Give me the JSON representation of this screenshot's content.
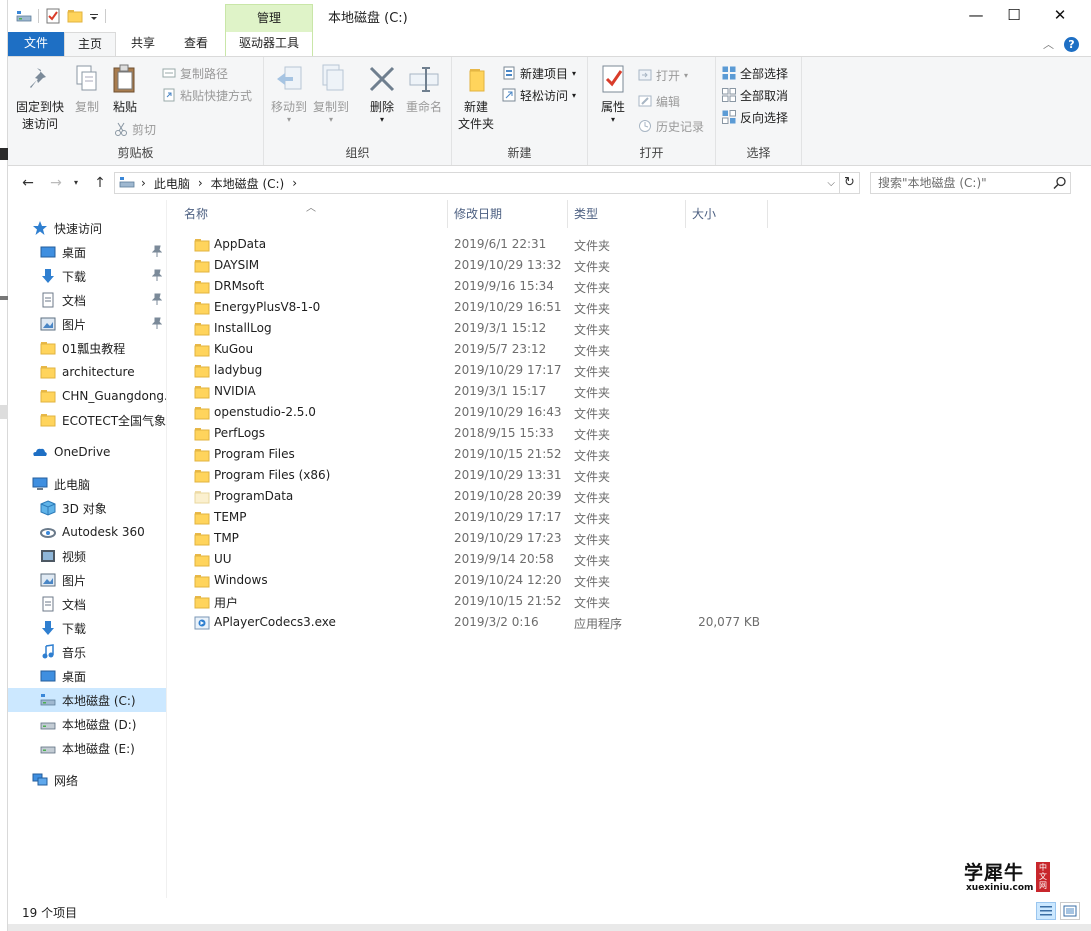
{
  "window": {
    "title": "本地磁盘 (C:)",
    "context_tab": "管理",
    "controls": {
      "minimize": "—",
      "maximize": "☐",
      "close": "✕"
    }
  },
  "tabs": {
    "file": "文件",
    "home": "主页",
    "share": "共享",
    "view": "查看",
    "drive_tools": "驱动器工具",
    "collapse": "︿",
    "help": "?"
  },
  "ribbon": {
    "clipboard": {
      "label": "剪贴板",
      "pin_quick_access": "固定到快\n速访问",
      "copy": "复制",
      "paste": "粘贴",
      "copy_path": "复制路径",
      "paste_shortcut": "粘贴快捷方式",
      "cut": "剪切"
    },
    "organize": {
      "label": "组织",
      "move_to": "移动到",
      "copy_to": "复制到",
      "delete": "删除",
      "rename": "重命名"
    },
    "new": {
      "label": "新建",
      "new_folder": "新建\n文件夹",
      "new_item": "新建项目",
      "easy_access": "轻松访问"
    },
    "open": {
      "label": "打开",
      "properties": "属性",
      "open": "打开",
      "edit": "编辑",
      "history": "历史记录"
    },
    "select": {
      "label": "选择",
      "select_all": "全部选择",
      "select_none": "全部取消",
      "invert": "反向选择"
    }
  },
  "address": {
    "crumbs": [
      "此电脑",
      "本地磁盘 (C:)"
    ],
    "search_placeholder": "搜索\"本地磁盘 (C:)\""
  },
  "nav": {
    "quick_access": "快速访问",
    "quick_items": [
      "桌面",
      "下载",
      "文档",
      "图片",
      "01瓢虫教程",
      "architecture",
      "CHN_Guangdong.",
      "ECOTECT全国气象"
    ],
    "onedrive": "OneDrive",
    "this_pc": "此电脑",
    "pc_items": [
      "3D 对象",
      "Autodesk 360",
      "视频",
      "图片",
      "文档",
      "下载",
      "音乐",
      "桌面",
      "本地磁盘 (C:)",
      "本地磁盘 (D:)",
      "本地磁盘 (E:)"
    ],
    "network": "网络"
  },
  "columns": {
    "name": "名称",
    "date": "修改日期",
    "type": "类型",
    "size": "大小"
  },
  "files": [
    {
      "name": "AppData",
      "date": "2019/6/1 22:31",
      "type": "文件夹",
      "size": "",
      "icon": "folder-icon"
    },
    {
      "name": "DAYSIM",
      "date": "2019/10/29 13:32",
      "type": "文件夹",
      "size": "",
      "icon": "folder-icon"
    },
    {
      "name": "DRMsoft",
      "date": "2019/9/16 15:34",
      "type": "文件夹",
      "size": "",
      "icon": "folder-icon"
    },
    {
      "name": "EnergyPlusV8-1-0",
      "date": "2019/10/29 16:51",
      "type": "文件夹",
      "size": "",
      "icon": "folder-icon"
    },
    {
      "name": "InstallLog",
      "date": "2019/3/1 15:12",
      "type": "文件夹",
      "size": "",
      "icon": "folder-icon"
    },
    {
      "name": "KuGou",
      "date": "2019/5/7 23:12",
      "type": "文件夹",
      "size": "",
      "icon": "folder-icon"
    },
    {
      "name": "ladybug",
      "date": "2019/10/29 17:17",
      "type": "文件夹",
      "size": "",
      "icon": "folder-icon"
    },
    {
      "name": "NVIDIA",
      "date": "2019/3/1 15:17",
      "type": "文件夹",
      "size": "",
      "icon": "folder-icon"
    },
    {
      "name": "openstudio-2.5.0",
      "date": "2019/10/29 16:43",
      "type": "文件夹",
      "size": "",
      "icon": "folder-icon"
    },
    {
      "name": "PerfLogs",
      "date": "2018/9/15 15:33",
      "type": "文件夹",
      "size": "",
      "icon": "folder-icon"
    },
    {
      "name": "Program Files",
      "date": "2019/10/15 21:52",
      "type": "文件夹",
      "size": "",
      "icon": "folder-icon"
    },
    {
      "name": "Program Files (x86)",
      "date": "2019/10/29 13:31",
      "type": "文件夹",
      "size": "",
      "icon": "folder-icon"
    },
    {
      "name": "ProgramData",
      "date": "2019/10/28 20:39",
      "type": "文件夹",
      "size": "",
      "icon": "hidden-folder-icon"
    },
    {
      "name": "TEMP",
      "date": "2019/10/29 17:17",
      "type": "文件夹",
      "size": "",
      "icon": "folder-icon"
    },
    {
      "name": "TMP",
      "date": "2019/10/29 17:23",
      "type": "文件夹",
      "size": "",
      "icon": "folder-icon"
    },
    {
      "name": "UU",
      "date": "2019/9/14 20:58",
      "type": "文件夹",
      "size": "",
      "icon": "folder-icon"
    },
    {
      "name": "Windows",
      "date": "2019/10/24 12:20",
      "type": "文件夹",
      "size": "",
      "icon": "folder-icon"
    },
    {
      "name": "用户",
      "date": "2019/10/15 21:52",
      "type": "文件夹",
      "size": "",
      "icon": "folder-icon"
    },
    {
      "name": "APlayerCodecs3.exe",
      "date": "2019/3/2 0:16",
      "type": "应用程序",
      "size": "20,077 KB",
      "icon": "exe-icon"
    }
  ],
  "status": {
    "count": "19 个项目"
  },
  "watermark": {
    "title": "学犀牛",
    "url": "xuexiniu.com",
    "seal": "中文网"
  },
  "colors": {
    "accent": "#1e6fc4",
    "context_tab": "#dff3c8",
    "selected": "#cce8ff",
    "folder": "#ffd45c"
  }
}
